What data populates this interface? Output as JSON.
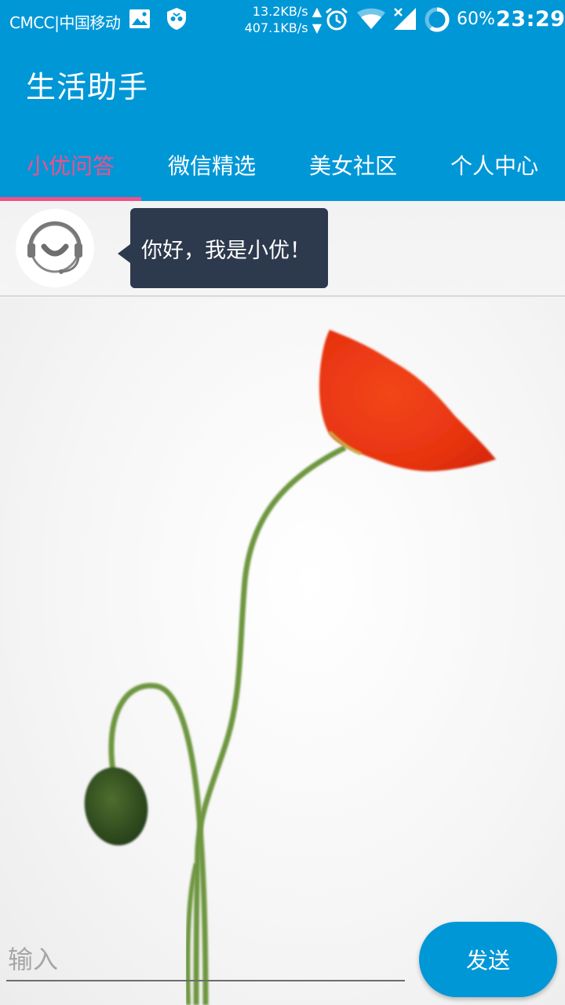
{
  "status_bar": {
    "carrier": "CMCC|中国移动",
    "speed_up": "13.2KB/s",
    "speed_down": "407.1KB/s",
    "battery": "60%",
    "time": "23:29",
    "icons": [
      "image-icon",
      "shield-icon",
      "alarm-icon",
      "wifi-icon",
      "signal-icon",
      "battery-icon"
    ]
  },
  "app_bar": {
    "title": "生活助手"
  },
  "tabs": [
    {
      "label": "小优问答",
      "active": true
    },
    {
      "label": "微信精选",
      "active": false
    },
    {
      "label": "美女社区",
      "active": false
    },
    {
      "label": "个人中心",
      "active": false
    }
  ],
  "chat": {
    "avatar_icon": "customer-service-icon",
    "greeting": "你好，我是小优！"
  },
  "input": {
    "placeholder": "输入",
    "value": "",
    "send_label": "发送"
  },
  "colors": {
    "primary": "#0097D7",
    "accent": "#F0508A",
    "bubble": "#2D3A4D"
  }
}
